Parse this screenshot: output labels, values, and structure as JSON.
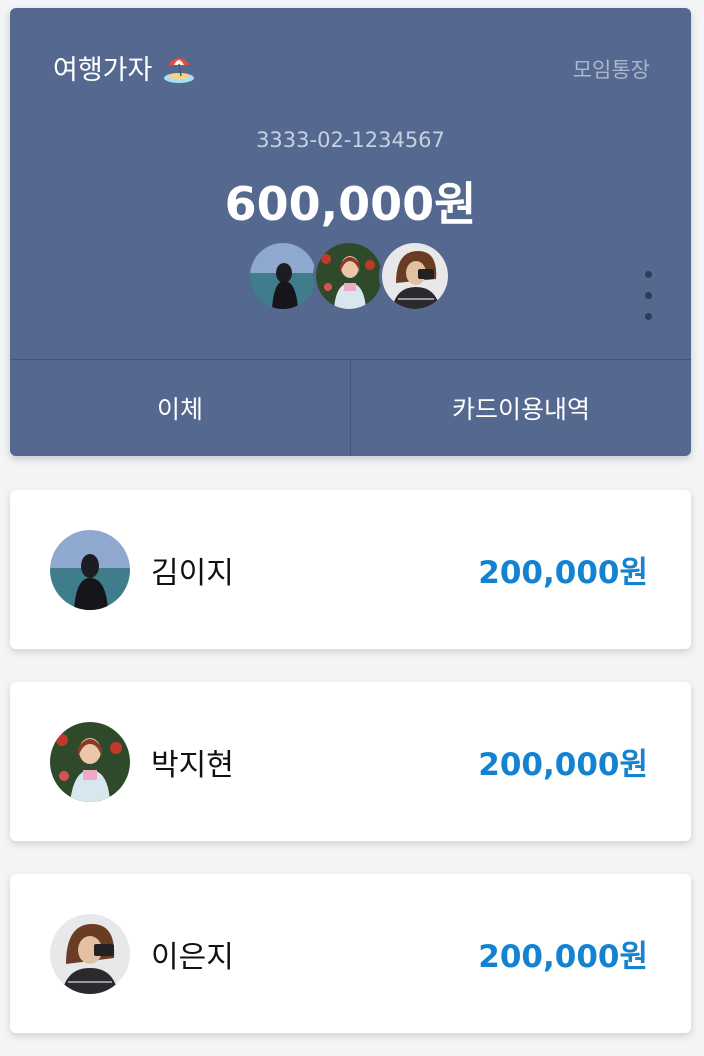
{
  "account": {
    "name": "여행가자",
    "type": "모임통장",
    "number": "3333-02-1234567",
    "balance": "600,000원",
    "avatars": [
      "avatar-sea",
      "avatar-flowers",
      "avatar-camera"
    ]
  },
  "actions": {
    "transfer": "이체",
    "card_history": "카드이용내역"
  },
  "members": [
    {
      "name": "김이지",
      "amount": "200,000원"
    },
    {
      "name": "박지현",
      "amount": "200,000원"
    },
    {
      "name": "이은지",
      "amount": "200,000원"
    }
  ],
  "colors": {
    "card_bg": "#55688f",
    "amount": "#1383d1"
  }
}
